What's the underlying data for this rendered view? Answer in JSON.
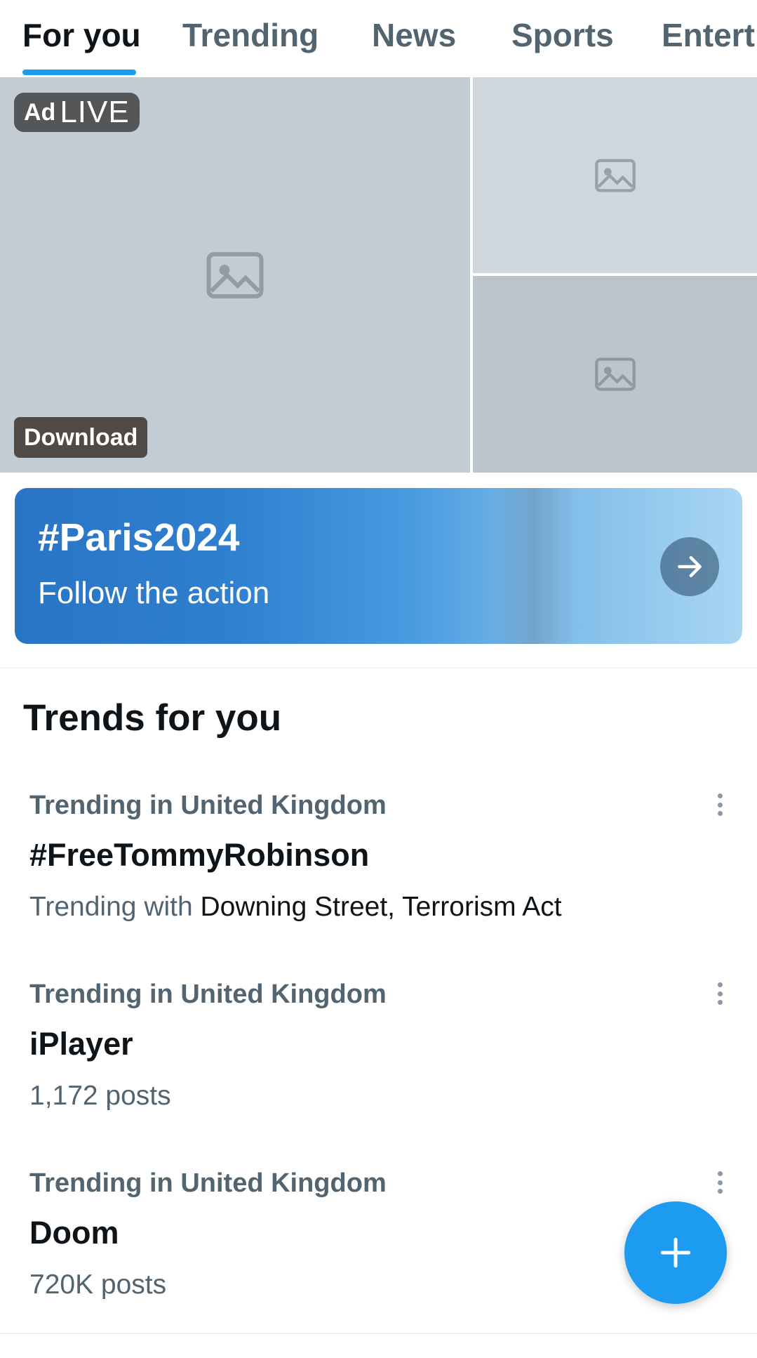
{
  "tabs": [
    {
      "label": "For you",
      "active": true
    },
    {
      "label": "Trending",
      "active": false
    },
    {
      "label": "News",
      "active": false
    },
    {
      "label": "Sports",
      "active": false
    },
    {
      "label": "Entert",
      "active": false
    }
  ],
  "ad": {
    "badge": "Ad",
    "live_label": "LIVE",
    "download_label": "Download"
  },
  "banner": {
    "title": "#Paris2024",
    "subtitle": "Follow the action",
    "icon": "arrow-right-icon"
  },
  "trends_section": {
    "title": "Trends for you",
    "items": [
      {
        "context": "Trending in United Kingdom",
        "name": "#FreeTommyRobinson",
        "meta_prefix": "Trending with ",
        "meta_strong": "Downing Street, Terrorism Act"
      },
      {
        "context": "Trending in United Kingdom",
        "name": "iPlayer",
        "meta_prefix": "1,172 posts",
        "meta_strong": ""
      },
      {
        "context": "Trending in United Kingdom",
        "name": "Doom",
        "meta_prefix": "720K posts",
        "meta_strong": ""
      }
    ]
  },
  "fab": {
    "icon": "plus-icon"
  },
  "colors": {
    "accent": "#1d9bf0",
    "text_primary": "#0f1419",
    "text_secondary": "#536471"
  }
}
